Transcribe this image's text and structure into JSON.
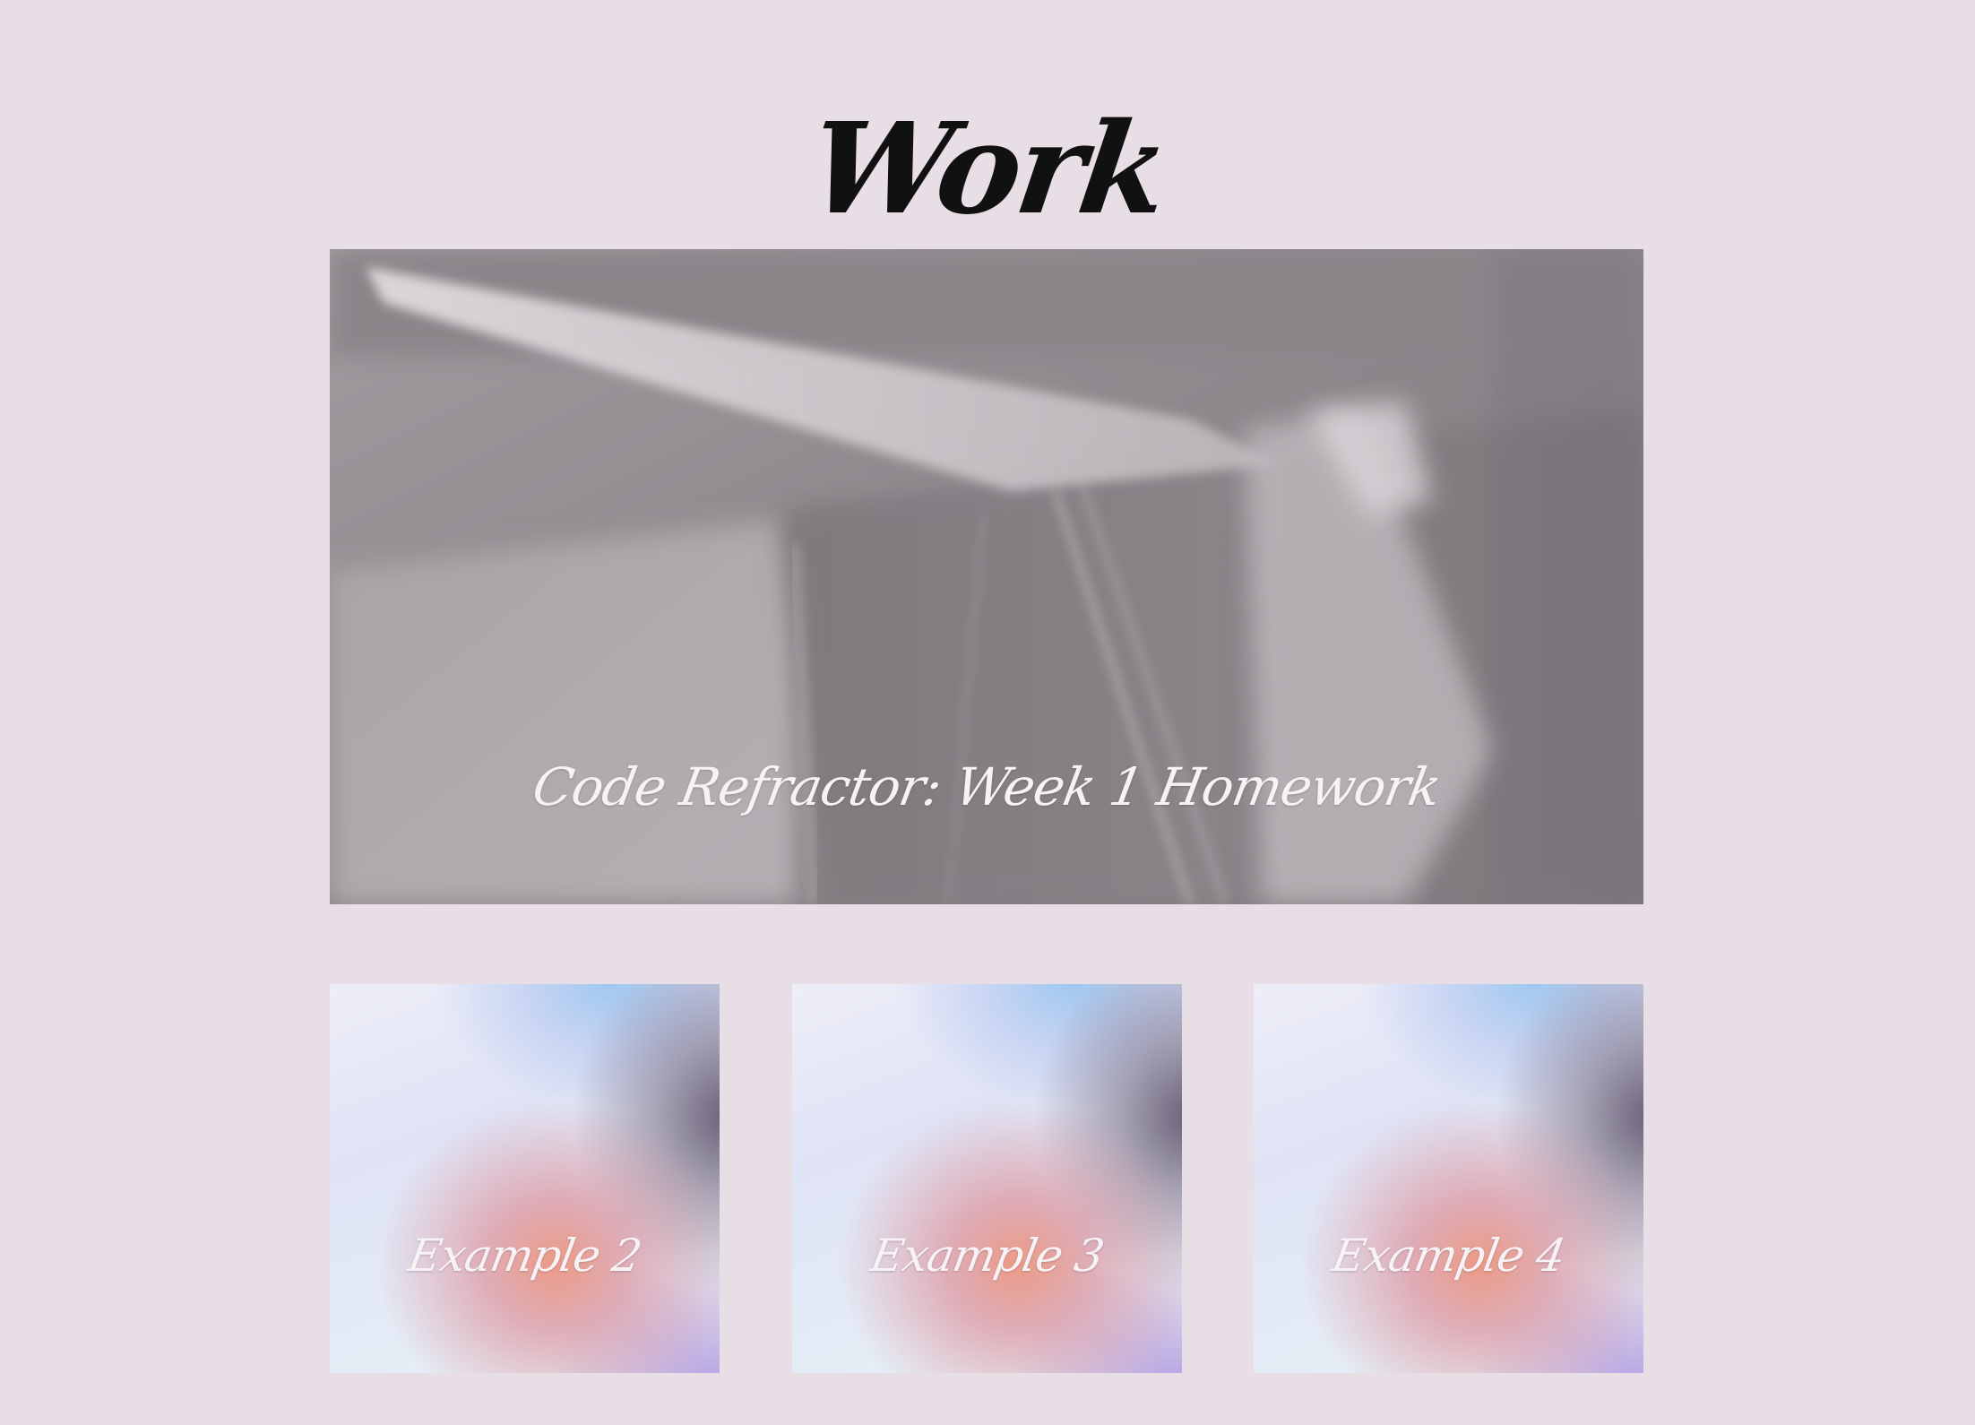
{
  "page": {
    "title": "Work"
  },
  "projects": {
    "featured": {
      "title": "Code Refractor: Week 1 Homework"
    },
    "tiles": [
      {
        "title": "Example 2"
      },
      {
        "title": "Example 3"
      },
      {
        "title": "Example 4"
      }
    ]
  },
  "colors": {
    "background": "#e8dfe6",
    "heading": "#111111",
    "caption": "#f7f2f6"
  }
}
